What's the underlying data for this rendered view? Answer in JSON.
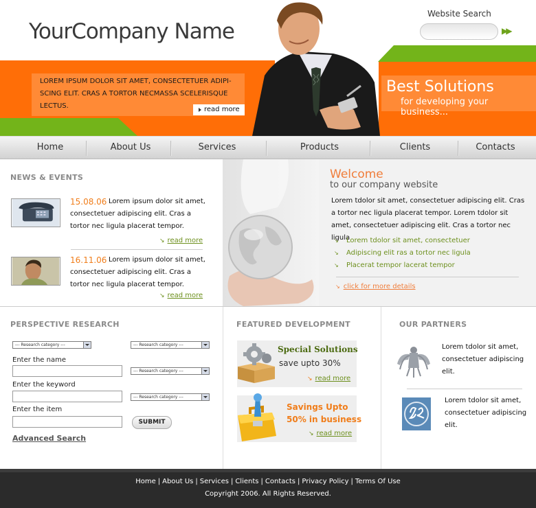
{
  "header": {
    "logo": "YourCompany Name",
    "search_label": "Website Search",
    "intro_text": "LOREM IPSUM DOLOR SIT AMET, CONSECTETUER ADIPI- SCING ELIT. CRAS A TORTOR NECMASSA SCELERISQUE LECTUS.",
    "read_more": "read more",
    "best_title": "Best Solutions",
    "best_sub": "for developing your business..."
  },
  "nav": {
    "items": [
      "Home",
      "About Us",
      "Services",
      "Products",
      "Clients",
      "Contacts"
    ]
  },
  "news": {
    "title": "NEWS & EVENTS",
    "items": [
      {
        "date": "15.08.06",
        "text": "Lorem ipsum dolor sit amet, consectetuer adipiscing elit. Cras a tortor nec ligula placerat tempor.",
        "more": "read more"
      },
      {
        "date": "16.11.06",
        "text": "Lorem ipsum dolor sit amet, consectetuer adipiscing elit. Cras a tortor nec ligula placerat tempor.",
        "more": "read more"
      }
    ]
  },
  "welcome": {
    "title": "Welcome",
    "subtitle": "to our company website",
    "text": "Lorem tdolor sit amet, consectetuer adipiscing elit. Cras a tortor nec ligula placerat tempor. Lorem tdolor sit amet, consectetuer adipiscing elit. Cras a tortor nec ligula",
    "list": [
      "Lorem tdolor sit amet, consectetuer",
      "Adipiscing elit ras a tortor nec ligula",
      "Placerat tempor lacerat tempor"
    ],
    "click_more": "click for more details"
  },
  "research": {
    "title": "PERSPECTIVE RESEARCH",
    "category_placeholder": "--- Research category ---",
    "name_label": "Enter the name",
    "keyword_label": "Enter the keyword",
    "item_label": "Enter the item",
    "submit": "SUBMIT",
    "advanced": "Advanced Search"
  },
  "featured": {
    "title": "FEATURED DEVELOPMENT",
    "box1_title": "Special Solutions",
    "box1_sub": "save upto 30%",
    "box1_more": "read more",
    "box2_line1": "Savings Upto",
    "box2_line2": "50% in business",
    "box2_more": "read more"
  },
  "partners": {
    "title": "OUR PARTNERS",
    "p1": "Lorem tdolor sit amet, consectetuer adipiscing elit.",
    "p2": "Lorem tdolor sit amet, consectetuer adipiscing elit."
  },
  "footer": {
    "links": [
      "Home",
      "About Us",
      "Services",
      "Clients",
      "Contacts",
      "Privacy Policy",
      "Terms Of Use"
    ],
    "copyright": "Copyright 2006. All Rights Reserved."
  },
  "colors": {
    "orange": "#ff6e07",
    "green": "#73b41a",
    "link_green": "#6c8f1c",
    "date_orange": "#f07d1a"
  }
}
